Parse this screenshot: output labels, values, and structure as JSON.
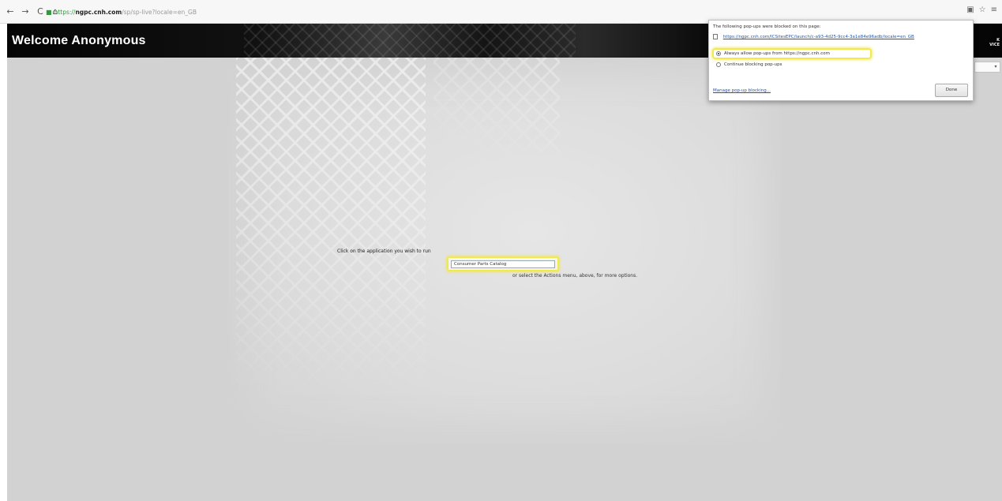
{
  "browser": {
    "url_scheme": "https://",
    "url_host": "ngpc.cnh.com",
    "url_path": "/sp/sp-live?locale=en_GB",
    "nav": {
      "back": "←",
      "forward": "→",
      "reload": "C",
      "home": "⌂",
      "lock": "🔒"
    },
    "toolbar_icons": {
      "popup_blocked": "▣",
      "star": "☆",
      "menu": "≡"
    }
  },
  "header": {
    "welcome": "Welcome Anonymous",
    "right_line1": "K",
    "right_line2": "VICE"
  },
  "main": {
    "instruction": "Click on the application you wish to run",
    "app_link": "Consumer Parts Catalog",
    "more_options": "or select the Actions menu, above, for more options."
  },
  "popup": {
    "title": "The following pop-ups were blocked on this page:",
    "blocked_url": "https://ngpc.cnh.com/ICSitesEPC/launch/c-a93-4d25-9cc4-3a1e84e96adb/locale=en_GB",
    "option_allow": "Always allow pop-ups from https://ngpc.cnh.com",
    "option_block": "Continue blocking pop-ups",
    "manage": "Manage pop-up blocking...",
    "done": "Done"
  },
  "colors": {
    "highlight": "#f2e94e",
    "link": "#2255aa",
    "header_bg": "#050505",
    "content_bg": "#d2d2d2"
  }
}
